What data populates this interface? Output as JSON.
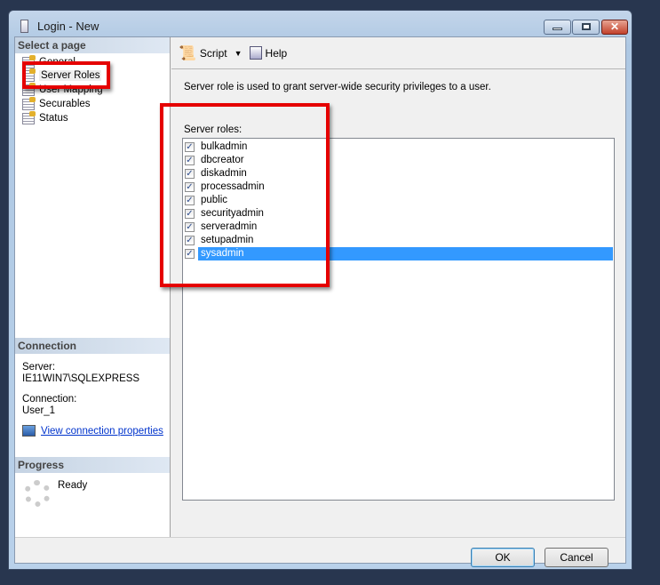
{
  "window": {
    "title": "Login - New",
    "close_glyph": "✕"
  },
  "sidebar": {
    "select_page_header": "Select a page",
    "pages": [
      {
        "label": "General"
      },
      {
        "label": "Server Roles"
      },
      {
        "label": "User Mapping"
      },
      {
        "label": "Securables"
      },
      {
        "label": "Status"
      }
    ],
    "connection_header": "Connection",
    "server_label": "Server:",
    "server_value": "IE11WIN7\\SQLEXPRESS",
    "connection_label": "Connection:",
    "connection_value": "User_1",
    "view_props_link": "View connection properties",
    "progress_header": "Progress",
    "progress_status": "Ready"
  },
  "toolbar": {
    "script_label": "Script",
    "help_label": "Help"
  },
  "main": {
    "description": "Server role is used to grant server-wide security privileges to a user.",
    "roles_label": "Server roles:",
    "roles": [
      {
        "name": "bulkadmin",
        "checked": true
      },
      {
        "name": "dbcreator",
        "checked": true
      },
      {
        "name": "diskadmin",
        "checked": true
      },
      {
        "name": "processadmin",
        "checked": true
      },
      {
        "name": "public",
        "checked": true
      },
      {
        "name": "securityadmin",
        "checked": true
      },
      {
        "name": "serveradmin",
        "checked": true
      },
      {
        "name": "setupadmin",
        "checked": true
      },
      {
        "name": "sysadmin",
        "checked": true,
        "selected": true
      }
    ]
  },
  "footer": {
    "ok_label": "OK",
    "cancel_label": "Cancel"
  },
  "colors": {
    "annotation": "#e50000",
    "selection": "#3399ff"
  }
}
